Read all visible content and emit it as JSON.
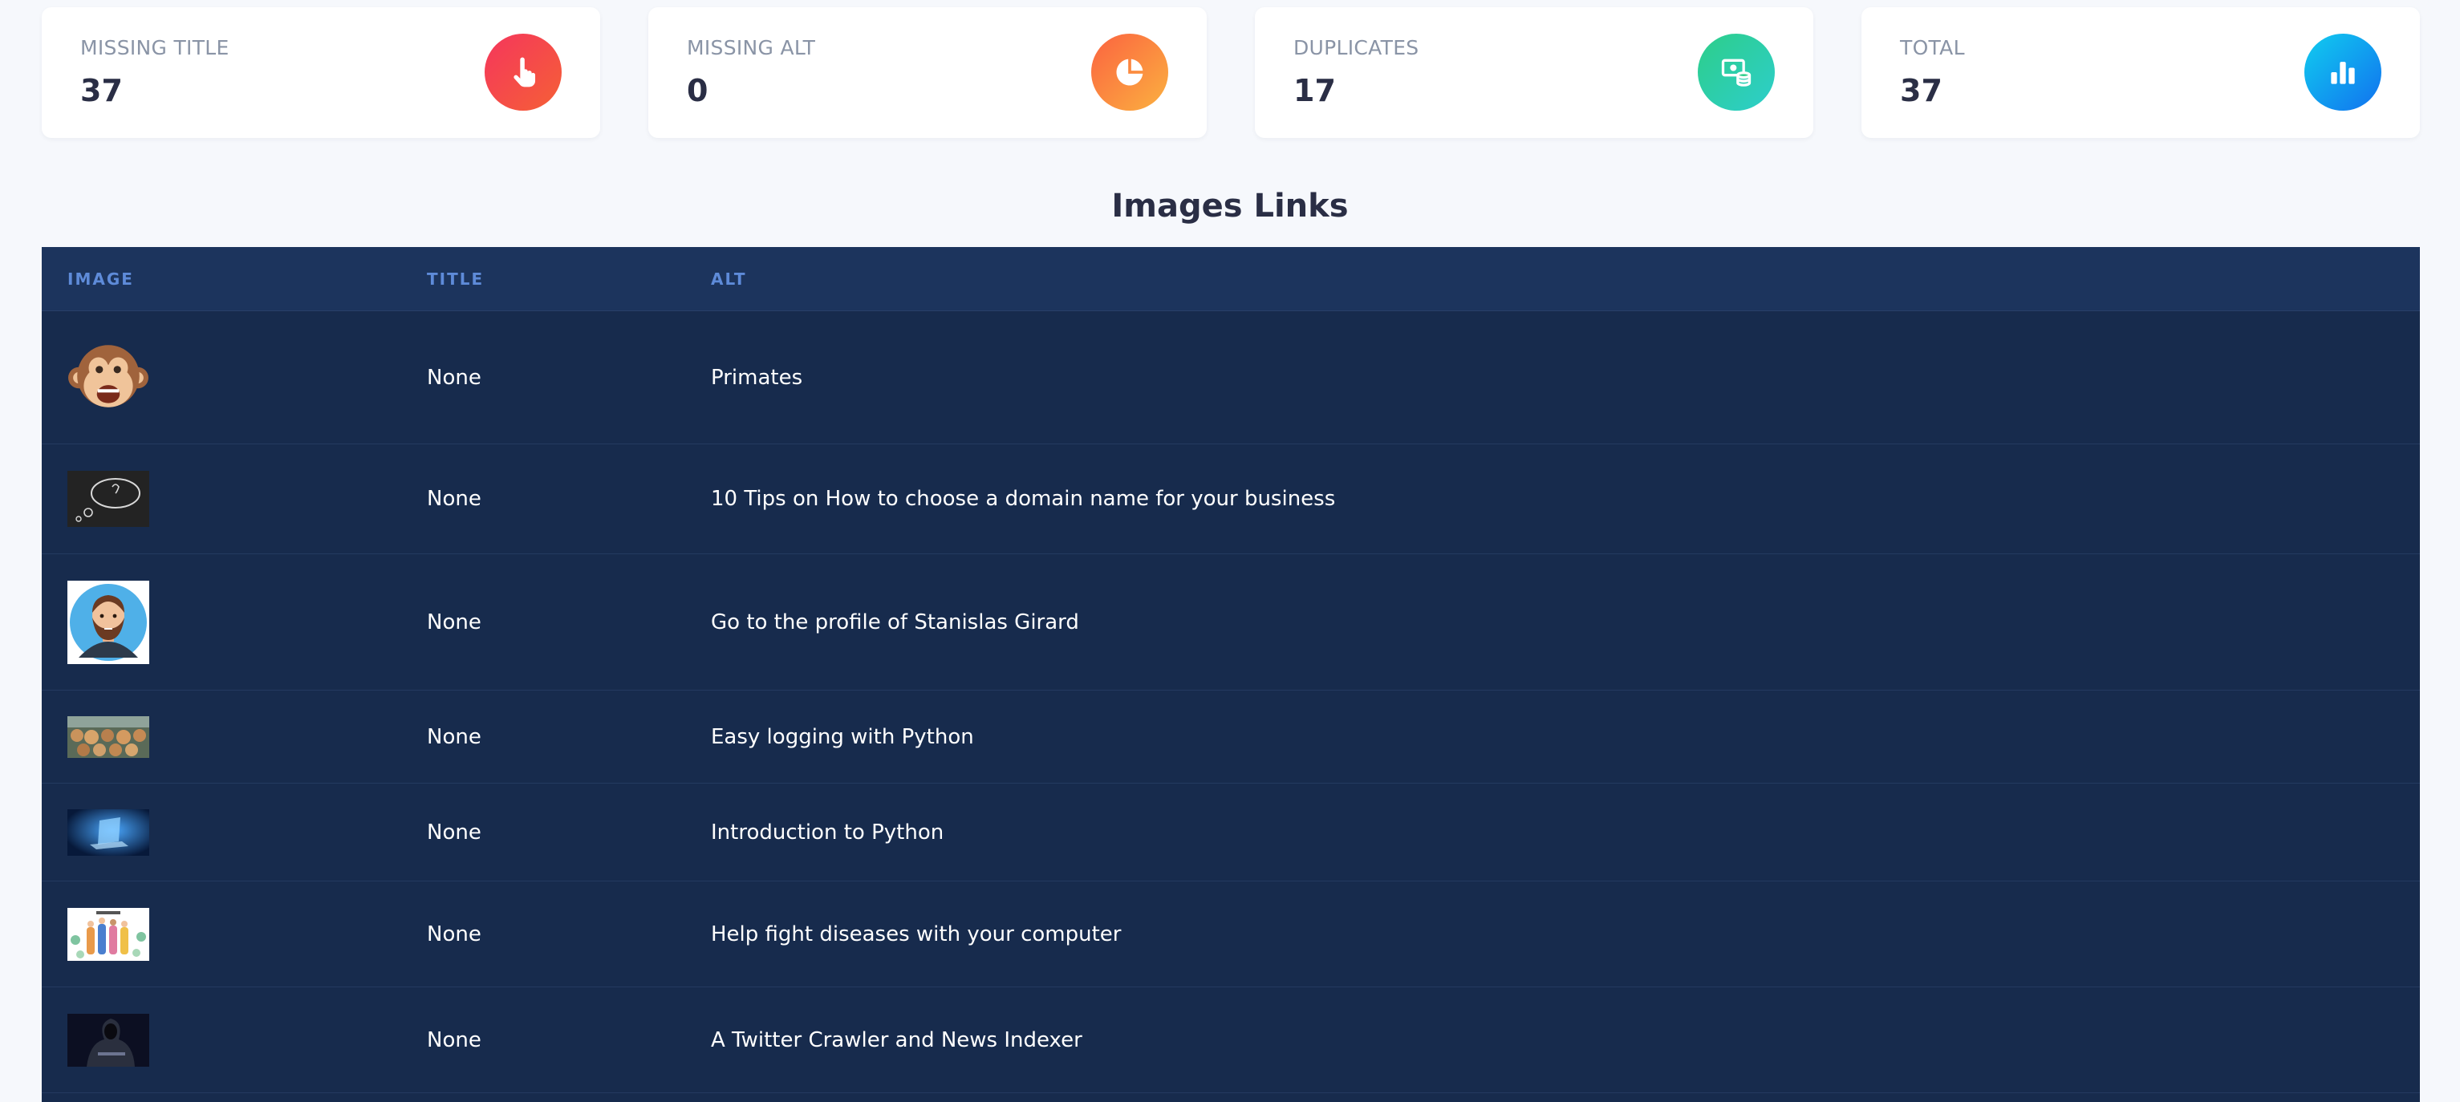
{
  "stats": [
    {
      "label": "MISSING TITLE",
      "value": "37",
      "icon": "hand-pointer-icon"
    },
    {
      "label": "MISSING ALT",
      "value": "0",
      "icon": "pie-chart-icon"
    },
    {
      "label": "DUPLICATES",
      "value": "17",
      "icon": "money-coins-icon"
    },
    {
      "label": "TOTAL",
      "value": "37",
      "icon": "bar-chart-icon"
    }
  ],
  "section": {
    "title": "Images Links"
  },
  "table": {
    "headers": {
      "image": "IMAGE",
      "title": "TITLE",
      "alt": "ALT"
    },
    "rows": [
      {
        "image": "monkey-emoji-thumbnail",
        "title": "None",
        "alt": "Primates"
      },
      {
        "image": "thought-bubble-chalkboard-thumbnail",
        "title": "None",
        "alt": "10 Tips on How to choose a domain name for your business"
      },
      {
        "image": "bearded-man-avatar-thumbnail",
        "title": "None",
        "alt": "Go to the profile of Stanislas Girard"
      },
      {
        "image": "stacked-logs-thumbnail",
        "title": "None",
        "alt": "Easy logging with Python"
      },
      {
        "image": "blue-laptop-thumbnail",
        "title": "None",
        "alt": "Introduction to Python"
      },
      {
        "image": "fight-virus-illustration-thumbnail",
        "title": "None",
        "alt": "Help fight diseases with your computer"
      },
      {
        "image": "hooded-figure-thumbnail",
        "title": "None",
        "alt": "A Twitter Crawler and News Indexer"
      }
    ]
  },
  "colors": {
    "page_bg": "#f6f8fc",
    "table_bg": "#172b4d",
    "table_header_bg": "#1c345d",
    "header_text": "#5e8bd9",
    "accent_red": "#f5365c",
    "accent_orange": "#fb6340",
    "accent_green": "#2dce89",
    "accent_blue": "#11cdef"
  }
}
